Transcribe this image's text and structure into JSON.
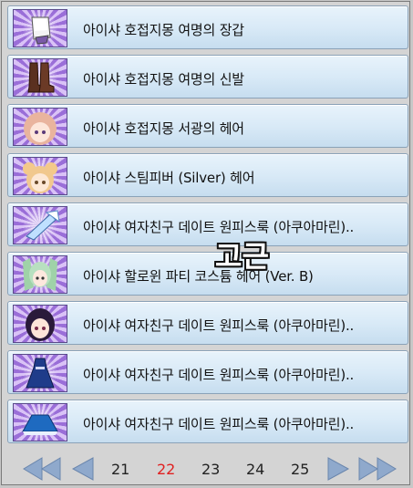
{
  "items": [
    {
      "label": "아이샤 호접지몽 여명의 장갑",
      "icon": "gloves-icon"
    },
    {
      "label": "아이샤 호접지몽 여명의 신발",
      "icon": "boots-icon"
    },
    {
      "label": "아이샤 호접지몽 서광의 헤어",
      "icon": "hair-icon"
    },
    {
      "label": "아이샤 스팀피버 (Silver) 헤어",
      "icon": "hair-icon"
    },
    {
      "label": "아이샤 여자친구 데이트 원피스룩 (아쿠아마린)..",
      "icon": "weapon-icon"
    },
    {
      "label": "아이샤 할로윈 파티 코스튬 헤어 (Ver. B)",
      "icon": "hair-icon"
    },
    {
      "label": "아이샤 여자친구 데이트 원피스룩 (아쿠아마린)..",
      "icon": "hair-icon"
    },
    {
      "label": "아이샤 여자친구 데이트 원피스룩 (아쿠아마린)..",
      "icon": "dress-icon"
    },
    {
      "label": "아이샤 여자친구 데이트 원피스룩 (아쿠아마린)..",
      "icon": "skirt-icon"
    }
  ],
  "overlay_text": "고근",
  "pagination": {
    "pages": [
      "21",
      "22",
      "23",
      "24",
      "25"
    ],
    "current": "22"
  },
  "colors": {
    "row_gradient_top": "#e8f3fb",
    "row_gradient_bottom": "#c6ddef",
    "thumb_purple": "#9a6ed8",
    "current_page": "#e02020",
    "arrow": "#8fa9cc"
  }
}
